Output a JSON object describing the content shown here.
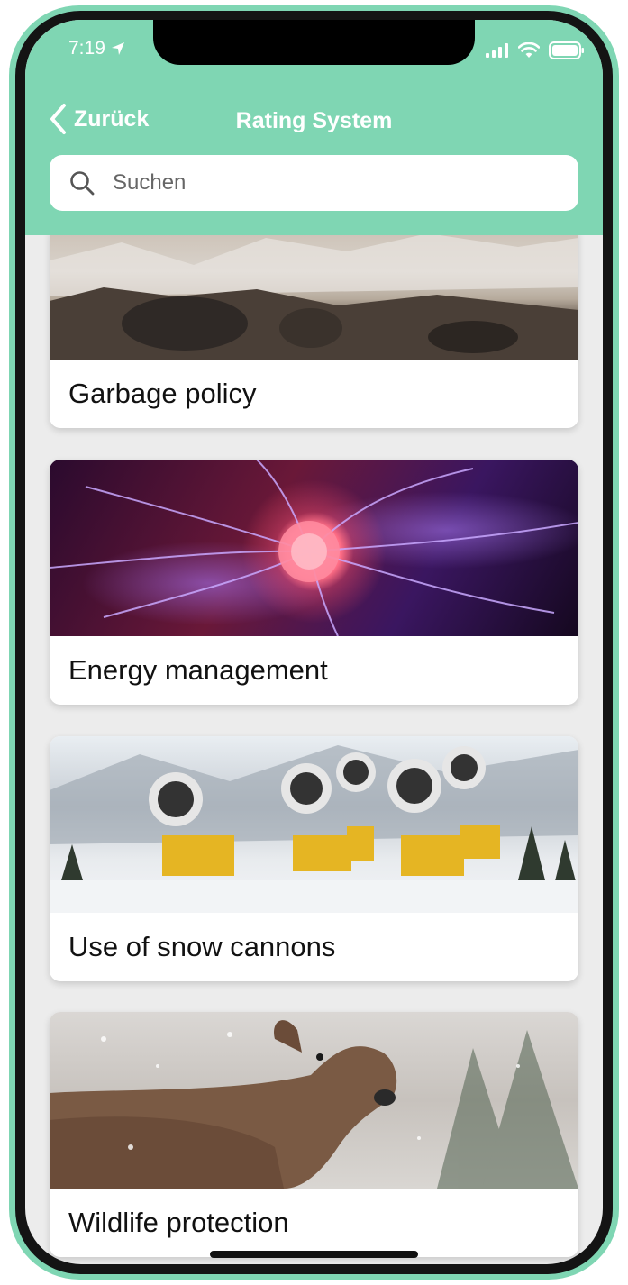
{
  "status_bar": {
    "time": "7:19"
  },
  "nav": {
    "back_label": "Zurück",
    "title": "Rating System"
  },
  "search": {
    "placeholder": "Suchen",
    "value": ""
  },
  "items": [
    {
      "label": "Garbage policy"
    },
    {
      "label": "Energy management"
    },
    {
      "label": "Use of snow cannons"
    },
    {
      "label": "Wildlife protection"
    }
  ],
  "colors": {
    "header": "#7fd6b3",
    "background": "#ececec"
  }
}
